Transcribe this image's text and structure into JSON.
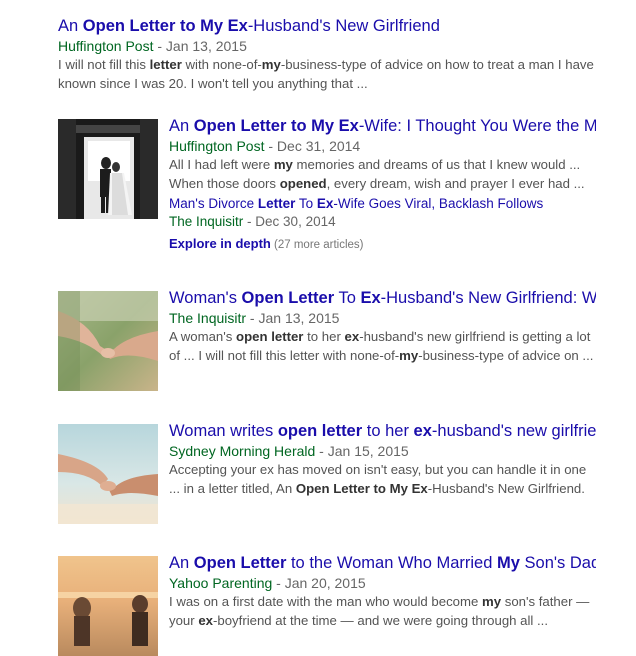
{
  "results": [
    {
      "title_parts": [
        {
          "t": "An "
        },
        {
          "t": "Open Letter to My Ex",
          "b": true
        },
        {
          "t": "-Husband's New Girlfriend"
        }
      ],
      "source": "Huffington Post",
      "date": " - Jan 13, 2015",
      "snippet_parts": [
        {
          "t": "I will not fill this "
        },
        {
          "t": "letter",
          "b": true
        },
        {
          "t": " with none-of-"
        },
        {
          "t": "my",
          "b": true
        },
        {
          "t": "-business-type of advice on how to treat a man I have known since I was 20. I won't tell you anything that ..."
        }
      ]
    },
    {
      "thumb": "wedding-doorway-photo",
      "title_parts": [
        {
          "t": "An "
        },
        {
          "t": "Open Letter to My Ex",
          "b": true
        },
        {
          "t": "-Wife: I Thought You Were the M..."
        }
      ],
      "source": "Huffington Post",
      "date": " - Dec 31, 2014",
      "snippet_parts": [
        {
          "t": "All I had left were "
        },
        {
          "t": "my",
          "b": true
        },
        {
          "t": " memories and dreams of us that I knew would ... When those doors "
        },
        {
          "t": "opened",
          "b": true
        },
        {
          "t": ", every dream, wish and prayer I ever had ..."
        }
      ],
      "sub_title_parts": [
        {
          "t": "Man's Divorce "
        },
        {
          "t": "Letter",
          "b": true
        },
        {
          "t": " To "
        },
        {
          "t": "Ex",
          "b": true
        },
        {
          "t": "-Wife Goes Viral, Backlash Follows"
        }
      ],
      "sub_source": "The Inquisitr",
      "sub_date": " - Dec 30, 2014",
      "explore_label": "Explore in depth",
      "explore_count": " (27 more articles)"
    },
    {
      "thumb": "holding-hands-photo",
      "title_parts": [
        {
          "t": "Woman's "
        },
        {
          "t": "Open Letter",
          "b": true
        },
        {
          "t": " To "
        },
        {
          "t": "Ex",
          "b": true
        },
        {
          "t": "-Husband's New Girlfriend: W..."
        }
      ],
      "source": "The Inquisitr",
      "date": " - Jan 13, 2015",
      "snippet_parts": [
        {
          "t": "A woman's "
        },
        {
          "t": "open letter",
          "b": true
        },
        {
          "t": " to her "
        },
        {
          "t": "ex",
          "b": true
        },
        {
          "t": "-husband's new girlfriend is getting a lot of ... I will not fill this letter with none-of-"
        },
        {
          "t": "my",
          "b": true
        },
        {
          "t": "-business-type of advice on ..."
        }
      ]
    },
    {
      "thumb": "beach-hands-photo",
      "title_parts": [
        {
          "t": "Woman writes "
        },
        {
          "t": "open letter",
          "b": true
        },
        {
          "t": " to her "
        },
        {
          "t": "ex",
          "b": true
        },
        {
          "t": "-husband's new girlfriend"
        }
      ],
      "source": "Sydney Morning Herald",
      "date": " - Jan 15, 2015",
      "snippet_parts": [
        {
          "t": "Accepting your ex has moved on isn't easy, but you can handle it in one ... in a letter titled, An "
        },
        {
          "t": "Open Letter to My Ex",
          "b": true
        },
        {
          "t": "-Husband's New Girlfriend."
        }
      ]
    },
    {
      "thumb": "beach-children-photo",
      "title_parts": [
        {
          "t": "An "
        },
        {
          "t": "Open Letter",
          "b": true
        },
        {
          "t": " to the Woman Who Married "
        },
        {
          "t": "My",
          "b": true
        },
        {
          "t": " Son's Dad"
        }
      ],
      "source": "Yahoo Parenting",
      "date": " - Jan 20, 2015",
      "snippet_parts": [
        {
          "t": "I was on a first date with the man who would become "
        },
        {
          "t": "my",
          "b": true
        },
        {
          "t": " son's father — your "
        },
        {
          "t": "ex",
          "b": true
        },
        {
          "t": "-boyfriend at the time — and we were going through all ..."
        }
      ]
    }
  ]
}
